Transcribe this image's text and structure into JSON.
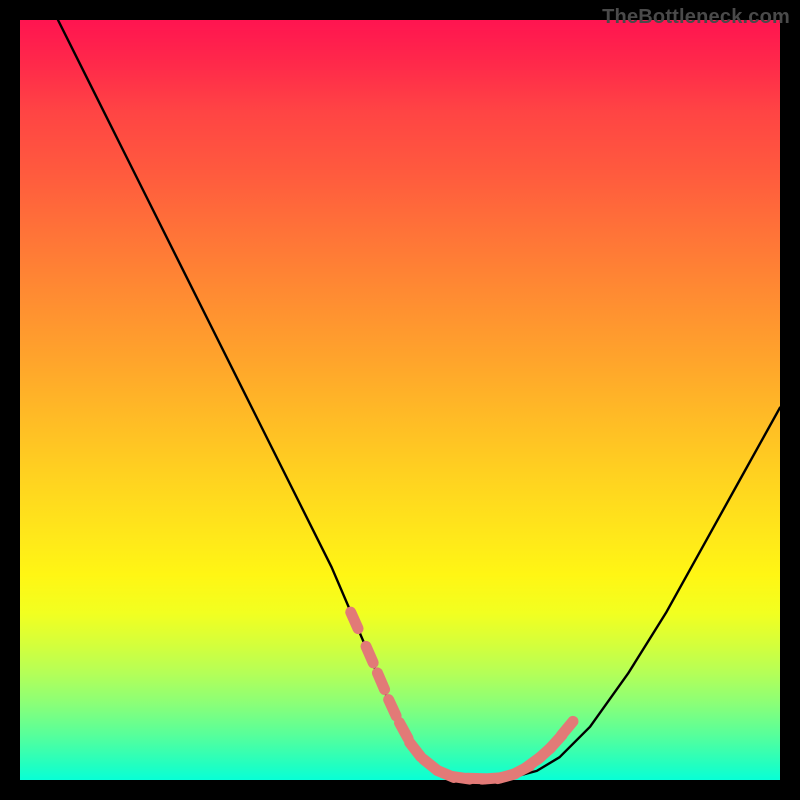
{
  "watermark": "TheBottleneck.com",
  "colors": {
    "background": "#000000",
    "curve": "#000000",
    "bead": "#e27a77"
  },
  "chart_data": {
    "type": "line",
    "title": "",
    "xlabel": "",
    "ylabel": "",
    "xlim": [
      0,
      100
    ],
    "ylim": [
      0,
      100
    ],
    "grid": false,
    "legend": false,
    "notes": "Axes unlabeled; background is a vertical gradient from red (high y) to green (low y). A single black curve descends steeply from the top-left, reaches ~0 along a flat trough, then rises to the right. Salmon beads mark the curve near the trough on both sides and along the flat bottom.",
    "series": [
      {
        "name": "curve",
        "x": [
          5,
          9,
          13,
          17,
          21,
          25,
          29,
          33,
          37,
          41,
          44,
          47,
          49.5,
          51,
          53,
          55,
          57,
          59,
          62,
          65,
          68,
          71,
          75,
          80,
          85,
          90,
          95,
          100
        ],
        "y": [
          100,
          92,
          84,
          76,
          68,
          60,
          52,
          44,
          36,
          28,
          21,
          14,
          8,
          5,
          2.5,
          1,
          0.4,
          0.2,
          0.2,
          0.4,
          1.2,
          3,
          7,
          14,
          22,
          31,
          40,
          49
        ]
      }
    ],
    "markers": {
      "name": "beads",
      "color": "#e27a77",
      "x": [
        44,
        46,
        47.5,
        49,
        50.5,
        52,
        54,
        56,
        58,
        60,
        62,
        64,
        66,
        67.5,
        69,
        70.5,
        72
      ],
      "y": [
        21,
        16.5,
        13,
        9.5,
        6.5,
        4,
        2,
        0.8,
        0.3,
        0.2,
        0.2,
        0.5,
        1.3,
        2.3,
        3.5,
        5,
        6.8
      ]
    }
  }
}
